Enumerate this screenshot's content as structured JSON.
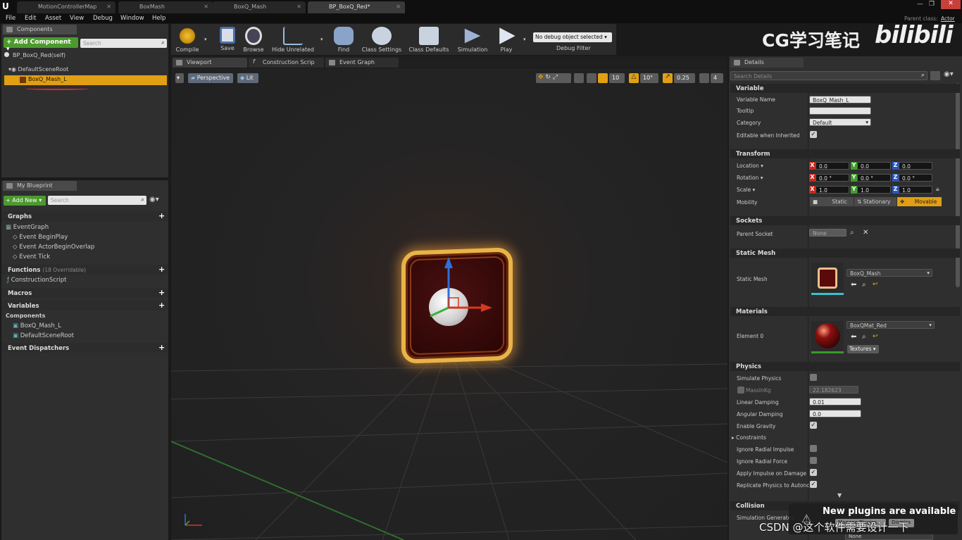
{
  "window": {
    "tabs": [
      {
        "label": "MotionControllerMap"
      },
      {
        "label": "BoxMash"
      },
      {
        "label": "BoxQ_Mash"
      },
      {
        "label": "BP_BoxQ_Red*"
      }
    ],
    "parent_class_label": "Parent class:",
    "parent_class_value": "Actor"
  },
  "menu": [
    "File",
    "Edit",
    "Asset",
    "View",
    "Debug",
    "Window",
    "Help"
  ],
  "components_panel": {
    "tab": "Components",
    "add_button": "+ Add Component ▾",
    "search_placeholder": "Search",
    "root_label": "BP_BoxQ_Red(self)",
    "scene_root": "DefaultSceneRoot",
    "selected_component": "BoxQ_Mash_L"
  },
  "my_blueprint": {
    "tab": "My Blueprint",
    "add_new": "+ Add New ▾",
    "search_placeholder": "Search",
    "graphs_header": "Graphs",
    "event_graph": "EventGraph",
    "events": [
      "Event BeginPlay",
      "Event ActorBeginOverlap",
      "Event Tick"
    ],
    "functions_header": "Functions",
    "functions_count": "(18 Overridable)",
    "construction_script": "ConstructionScript",
    "macros_header": "Macros",
    "variables_header": "Variables",
    "components_header": "Components",
    "components": [
      "BoxQ_Mash_L",
      "DefaultSceneRoot"
    ],
    "dispatchers_header": "Event Dispatchers"
  },
  "toolbar": {
    "buttons": [
      "Compile",
      "Save",
      "Browse",
      "Hide Unrelated",
      "Find",
      "Class Settings",
      "Class Defaults",
      "Simulation",
      "Play"
    ],
    "debug_select": "No debug object selected ▾",
    "debug_filter": "Debug Filter"
  },
  "editor_tabs": [
    "Viewport",
    "Construction Scrip",
    "Event Graph"
  ],
  "viewport": {
    "perspective": "Perspective",
    "lit": "Lit",
    "grid_snap": "10",
    "rot_snap": "10°",
    "scale_snap": "0.25",
    "cam_speed": "4"
  },
  "watermark": {
    "title": "CG学习笔记",
    "logo": "bilibili"
  },
  "details": {
    "tab": "Details",
    "search_placeholder": "Search Details",
    "variable_section": "Variable",
    "variable_name_label": "Variable Name",
    "variable_name_value": "BoxQ_Mash_L",
    "tooltip_label": "Tooltip",
    "category_label": "Category",
    "category_value": "Default",
    "editable_label": "Editable when Inherited",
    "transform_section": "Transform",
    "location_label": "Location ▾",
    "location": [
      "0.0",
      "0.0",
      "0.0"
    ],
    "rotation_label": "Rotation ▾",
    "rotation": [
      "0.0 °",
      "0.0 °",
      "0.0 °"
    ],
    "scale_label": "Scale ▾",
    "scale": [
      "1.0",
      "1.0",
      "1.0"
    ],
    "mobility_label": "Mobility",
    "mobility_options": [
      "Static",
      "Stationary",
      "Movable"
    ],
    "sockets_section": "Sockets",
    "parent_socket_label": "Parent Socket",
    "parent_socket_value": "None",
    "static_mesh_section": "Static Mesh",
    "static_mesh_label": "Static Mesh",
    "static_mesh_value": "BoxQ_Mash",
    "materials_section": "Materials",
    "element0_label": "Element 0",
    "material_value": "BoxQMat_Red",
    "textures_button": "Textures ▾",
    "physics_section": "Physics",
    "simulate_physics": "Simulate Physics",
    "mass_label": "MassInKg",
    "mass_value": "22.182623",
    "linear_damping_label": "Linear Damping",
    "linear_damping_value": "0.01",
    "angular_damping_label": "Angular Damping",
    "angular_damping_value": "0.0",
    "enable_gravity": "Enable Gravity",
    "constraints": "Constraints",
    "ignore_radial_impulse": "Ignore Radial Impulse",
    "ignore_radial_force": "Ignore Radial Force",
    "apply_impulse": "Apply Impulse on Damage",
    "replicate_physics": "Replicate Physics to Autonc",
    "collision_section": "Collision",
    "simulation_generates": "Simulation Generates",
    "collision_value": "None"
  },
  "notification": {
    "title": "New plugins are available",
    "manage": "Manage Plugins...",
    "dismiss": "Dismiss"
  },
  "csdn_watermark": "CSDN @这个软件需要设计一下"
}
